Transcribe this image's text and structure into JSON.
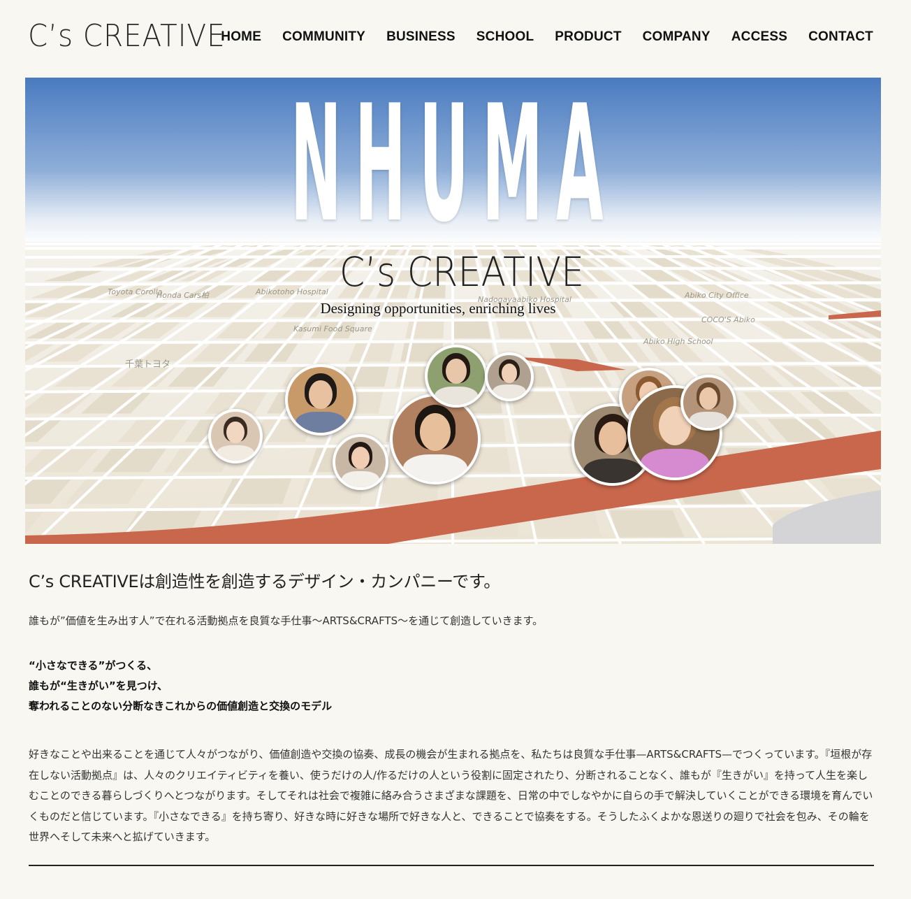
{
  "header": {
    "logo": "C’s CREATIVE",
    "nav": [
      "HOME",
      "COMMUNITY",
      "BUSINESS",
      "SCHOOL",
      "PRODUCT",
      "COMPANY",
      "ACCESS",
      "CONTACT"
    ]
  },
  "hero": {
    "title": "NHUMA",
    "logo": "C’s CREATIVE",
    "tagline": "Designing opportunities, enriching lives",
    "map_labels": [
      "Toyota Corolla",
      "Honda Cars柏",
      "Abikotoho Hospital",
      "Nadogayaabiko Hospital",
      "Kasumi Food Square",
      "Abiko City Office",
      "COCO'S Abiko",
      "Abiko High School",
      "千葉トヨタ"
    ]
  },
  "main": {
    "heading": "C’s CREATIVEは創造性を創造するデザイン・カンパニーです。",
    "lead": "誰もが”価値を生み出す人”で在れる活動拠点を良質な手仕事〜ARTS&CRAFTS〜を通じて創造していきます。",
    "bold_lines": [
      "“小さなできる”がつくる、",
      "誰もが“生きがい”を見つけ、",
      "奪われることのない分断なきこれからの価値創造と交換のモデル"
    ],
    "body": "好きなことや出来ることを通じて人々がつながり、価値創造や交換の協奏、成長の機会が生まれる拠点を、私たちは良質な手仕事—ARTS&CRAFTS—でつくっています。『垣根が存在しない活動拠点』は、人々のクリエイティビティを養い、使うだけの人/作るだけの人という役割に固定されたり、分断されることなく、誰もが『生きがい』を持って人生を楽しむことのできる暮らしづくりへとつながります。そしてそれは社会で複雑に絡み合うさまざまな課題を、日常の中でしなやかに自らの手で解決していくことができる環境を育んでいくものだと信じています。『小さなできる』を持ち寄り、好きな時に好きな場所で好きな人と、できることで協奏をする。そうしたふくよかな恩送りの廻りで社会を包み、その輪を世界へそして未来へと拡げていきます。"
  },
  "colors": {
    "background": "#f8f7f1",
    "sky_top": "#4a7bc0",
    "road": "#c9674c",
    "map_ground": "#efe9dc"
  }
}
